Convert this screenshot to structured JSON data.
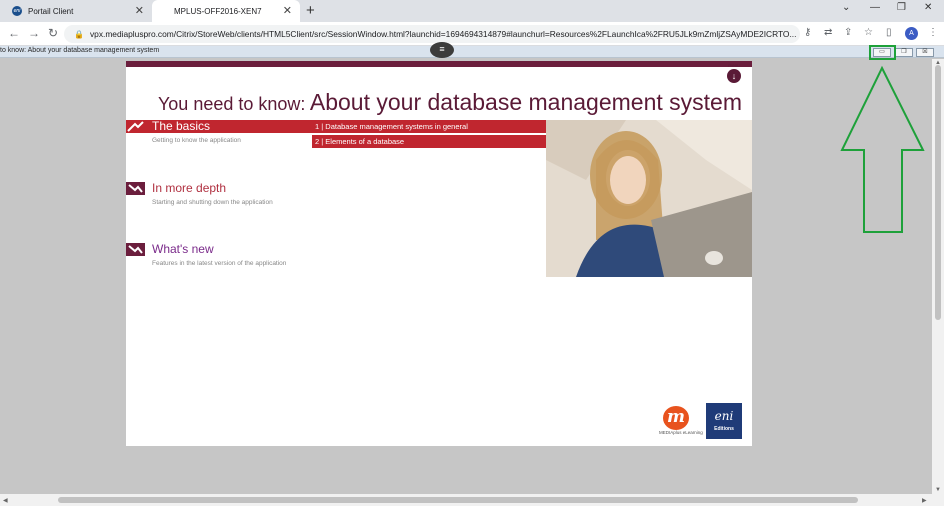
{
  "browser": {
    "tabs": [
      {
        "label": "Portail Client",
        "active": false
      },
      {
        "label": "MPLUS-OFF2016-XEN7",
        "active": true
      }
    ],
    "url": "vpx.mediapluspro.com/Citrix/StoreWeb/clients/HTML5Client/src/SessionWindow.html?launchid=1694694314879#launchurl=Resources%2FLaunchIca%2FRU5JLk9mZmljZSAyMDE2ICRTO...",
    "avatar_letter": "A",
    "window_controls": {
      "minimize": "⌄",
      "restore": "—",
      "maximize": "❐",
      "close": "✕"
    }
  },
  "citrix": {
    "session_title": "to know: About your database management system",
    "handle_glyph": "≡"
  },
  "page": {
    "menu_label": "menu",
    "headline_small": "You need to know:",
    "headline_big": "About your database management system",
    "sections": [
      {
        "title": "The basics",
        "subtitle": "Getting to know the application"
      },
      {
        "title": "In more depth",
        "subtitle": "Starting and shutting down the application"
      },
      {
        "title": "What's new",
        "subtitle": "Features in the latest version of the application"
      }
    ],
    "submenu": [
      "1 | Database management systems in general",
      "2 | Elements of a database"
    ],
    "logos": {
      "mediaplus_letter": "m",
      "mediaplus_text": "MEDIAplus eLearning",
      "eni_text": "eni",
      "eni_sub": "Editions"
    }
  },
  "colors": {
    "accent_red": "#c0262f",
    "plum": "#5a1a36",
    "highlight_green": "#1ea13a"
  }
}
